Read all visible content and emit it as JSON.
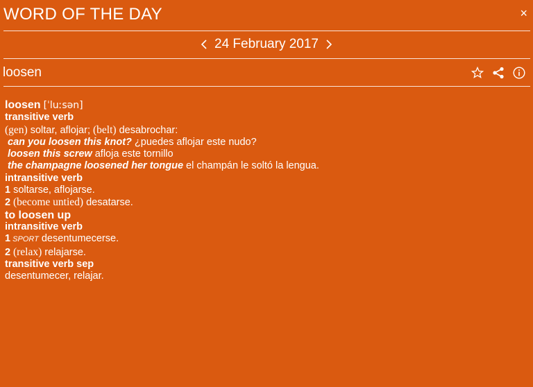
{
  "header": {
    "title": "WORD OF THE DAY",
    "close_label": "×"
  },
  "datebar": {
    "prev_label": "<",
    "date": "24 February 2017",
    "next_label": ">"
  },
  "wordbar": {
    "word": "loosen"
  },
  "entry": {
    "headword": "loosen",
    "pronunciation": "[ˈluːsən]",
    "pos_transitive": "transitive verb",
    "sense1_label": "(gen)",
    "sense1_a": " soltar, aflojar; ",
    "sense1_label2": "(belt)",
    "sense1_b": " desabrochar:",
    "ex1_src": "can you loosen this knot?",
    "ex1_tr": " ¿puedes aflojar este nudo?",
    "ex2_src": "loosen this screw",
    "ex2_tr": " afloja este tornillo",
    "ex3_src": "the champagne loosened her tongue",
    "ex3_tr": " el champán le soltó la lengua.",
    "pos_intransitive": "intransitive verb",
    "iv1_num": "1",
    "iv1_text": " soltarse, aflojarse.",
    "iv2_num": "2",
    "iv2_label": " (become untied)",
    "iv2_text": " desatarse.",
    "phrasal": "to loosen up",
    "pos_intransitive2": "intransitive verb",
    "up1_num": "1",
    "up1_label": " SPORT",
    "up1_text": " desentumecerse.",
    "up2_num": "2",
    "up2_label": " (relax)",
    "up2_text": " relajarse.",
    "pos_tvsep": "transitive verb sep",
    "tvsep_text": "desentumecer, relajar."
  },
  "colors": {
    "background": "#DA5A10",
    "text": "#FFFFFF"
  },
  "icons": [
    "close-icon",
    "chevron-left-icon",
    "chevron-right-icon",
    "star-icon",
    "share-icon",
    "info-icon"
  ]
}
